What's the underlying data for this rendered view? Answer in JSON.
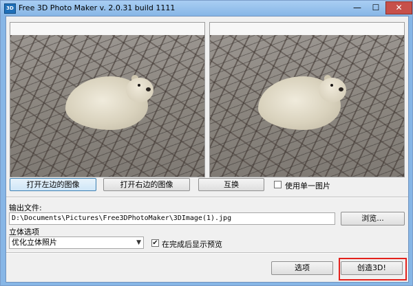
{
  "window": {
    "title": "Free 3D Photo Maker  v. 2.0.31 build 1111",
    "app_icon": "3D"
  },
  "titlebar_buttons": {
    "minimize": "—",
    "maximize": "☐",
    "close": "✕"
  },
  "previews": {
    "left_name": "left-preview",
    "right_name": "right-preview"
  },
  "buttons": {
    "open_left": "打开左边的图像",
    "open_right": "打开右边的图像",
    "swap": "互换",
    "browse": "浏览...",
    "options": "选项",
    "create": "创造3D!"
  },
  "single_image": {
    "label": "使用单一图片",
    "checked": false
  },
  "output": {
    "label": "输出文件:",
    "path": "D:\\Documents\\Pictures\\Free3DPhotoMaker\\3DImage(1).jpg"
  },
  "stereo": {
    "label": "立体选项",
    "selected": "优化立体照片"
  },
  "preview_after": {
    "label": "在完成后显示预览",
    "checked": true,
    "check_mark": "✔"
  },
  "accent": {
    "highlight": "#e3201b",
    "titlebar": "#87b6e6"
  }
}
